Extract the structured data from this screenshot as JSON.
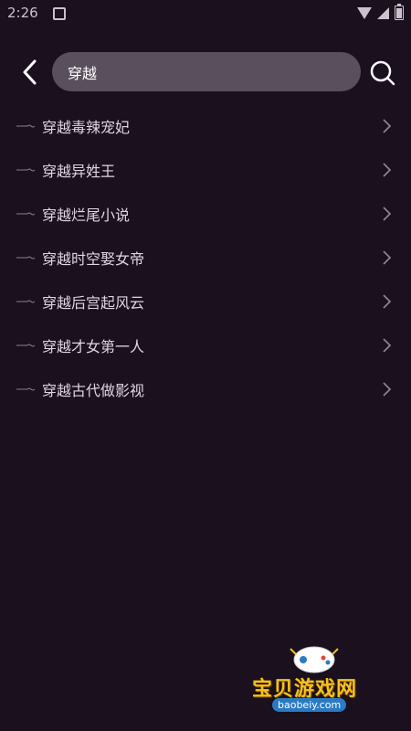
{
  "status_bar": {
    "time": "2:26"
  },
  "header": {
    "back_icon": "chevron-left-icon",
    "search_value": "穿越",
    "search_icon": "search-icon"
  },
  "suggestions": [
    {
      "label": "穿越毒辣宠妃"
    },
    {
      "label": "穿越异姓王"
    },
    {
      "label": "穿越烂尾小说"
    },
    {
      "label": "穿越时空娶女帝"
    },
    {
      "label": "穿越后宫起风云"
    },
    {
      "label": "穿越才女第一人"
    },
    {
      "label": "穿越古代做影视"
    }
  ],
  "watermark": {
    "title": "宝贝游戏网",
    "url": "baobeiy.com"
  },
  "colors": {
    "background": "#1b101d",
    "search_box": "#5a4f5c",
    "watermark_gold": "#f4c21b"
  }
}
